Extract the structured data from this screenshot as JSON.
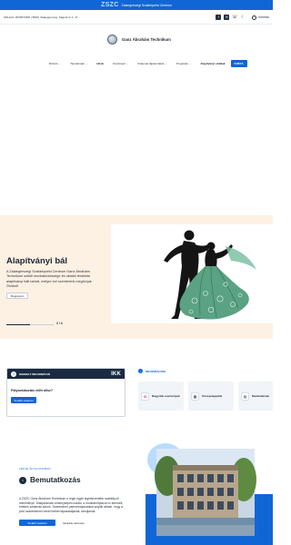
{
  "top_strip": {
    "logo": "ZSZC",
    "text": "Zalaegerszegi Szakképzési Centrum"
  },
  "contact_bar": {
    "text": "OM-kód: 203067/006 | 8900, Zalaegerszeg, Ságodi út 1.-17.",
    "icons": [
      "facebook-icon",
      "email-icon",
      "phone-icon",
      "moon-icon"
    ],
    "search_label": "Keresés"
  },
  "brand": {
    "name": "Ganz Ábrahám Technikum"
  },
  "nav": {
    "items": [
      {
        "label": "Rólunk",
        "has_menu": true
      },
      {
        "label": "Tanulóknak",
        "has_menu": true
      },
      {
        "label": "Hírek",
        "has_menu": false,
        "active": true
      },
      {
        "label": "Képzések",
        "has_menu": true
      },
      {
        "label": "Szakmai tájékoztatók",
        "has_menu": true
      },
      {
        "label": "Projektek",
        "has_menu": true
      }
    ],
    "link_label": "Alapítványi oldalak",
    "login_label": "KRÉTA"
  },
  "hero": {
    "title": "Alapítványi bál",
    "text": "A Zalaegerszegi Szakképzési Centrum Ganz Ábrahám Technikum szülői munkaközössége és oktatói testülete alapítványi bált tartott, melyre ezt szeretnénk meghívjuk Önöket!",
    "button_label": "Megnézem",
    "pager": "2 / 4",
    "progress": 0.5
  },
  "featured": {
    "label": "KIEMELT INFORMÁCIÓ",
    "logo": "IKK",
    "question": "Pályaválasztás előtt állsz?",
    "button_label": "Tovább olvasom"
  },
  "infos": {
    "label": "INFORMÁCIÓK",
    "cards": [
      {
        "icon": "photo-icon",
        "label": "Nagyobb események"
      },
      {
        "icon": "calendar-icon",
        "label": "Ünnepnapjaink"
      },
      {
        "icon": "briefcase-icon",
        "label": "Munkatársak"
      }
    ]
  },
  "about": {
    "tag": "LÉPJE ÁLTALUNKBAN",
    "title": "Bemutatkozás",
    "text": "A ZSZC Ganz Ábrahám Technikum a régió egyik legelismertebb szakképző intézménye. Diákjainknak versenyképes tudást, a munkaerőpiacon is keresett, értékes szakmák adunk. Szakemberi partnerkapcsolatai segítik abban, hogy a jövő szakemberei minél többet tapasztaljanak, tanuljanak.",
    "primary_label": "Tovább olvasom",
    "secondary_label": "Iskolánk története"
  },
  "colors": {
    "brand_blue": "#1166d6",
    "navy": "#1b2a3f",
    "hero_bg": "#fdf1e3",
    "dress_green": "#5aa283"
  }
}
